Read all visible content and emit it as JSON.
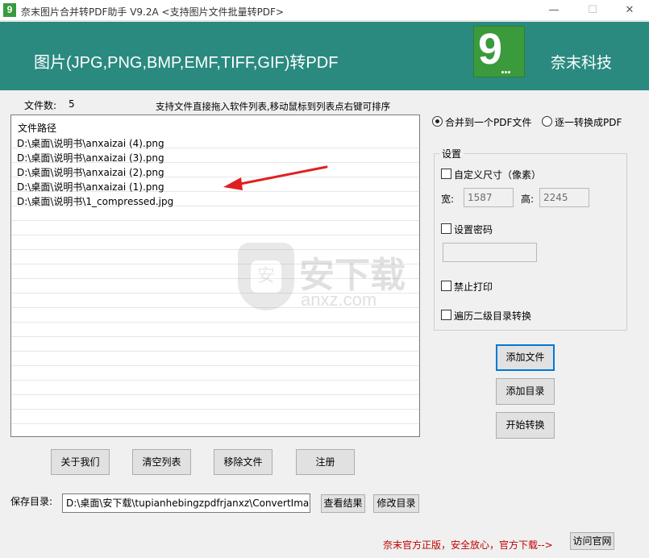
{
  "window": {
    "title": "奈末图片合并转PDF助手 V9.2A  <支持图片文件批量转PDF>",
    "icon": "9",
    "controls": {
      "minimize": "—",
      "maximize": "☐",
      "close": "✕"
    }
  },
  "banner": {
    "title": "图片(JPG,PNG,BMP,EMF,TIFF,GIF)转PDF",
    "logo_digit": "9",
    "logo_dots": "...",
    "brand": "奈末科技",
    "color": "#2a8a80"
  },
  "file_info": {
    "count_label": "文件数:",
    "count_value": "5",
    "hint": "支持文件直接拖入软件列表,移动鼠标到列表点右键可排序"
  },
  "file_list": {
    "header": "文件路径",
    "rows": [
      "D:\\桌面\\说明书\\anxaizai (4).png",
      "D:\\桌面\\说明书\\anxaizai (3).png",
      "D:\\桌面\\说明书\\anxaizai (2).png",
      "D:\\桌面\\说明书\\anxaizai (1).png",
      "D:\\桌面\\说明书\\1_compressed.jpg"
    ]
  },
  "watermark": {
    "main": "安下载",
    "sub": "anxz.com",
    "glyph": "安"
  },
  "mode": {
    "merge_label": "合并到一个PDF文件",
    "each_label": "逐一转换成PDF",
    "selected": "merge"
  },
  "settings": {
    "title": "设置",
    "custom_size_label": "自定义尺寸（像素）",
    "width_label": "宽:",
    "width_value": "1587",
    "height_label": "高:",
    "height_value": "2245",
    "password_label": "设置密码",
    "password_value": "",
    "no_print_label": "禁止打印",
    "traverse_label": "遍历二级目录转换"
  },
  "actions": {
    "add_file": "添加文件",
    "add_folder": "添加目录",
    "start": "开始转换"
  },
  "bottom_buttons": {
    "about": "关于我们",
    "clear": "清空列表",
    "remove": "移除文件",
    "register": "注册"
  },
  "save": {
    "label": "保存目录:",
    "path": "D:\\桌面\\安下载\\tupianhebingzpdfrjanxz\\ConvertImageT",
    "view_result": "查看结果",
    "change_dir": "修改目录"
  },
  "footer": {
    "note": "奈末官方正版，安全放心，官方下载-->",
    "visit": "访问官网",
    "note_color": "#c00000"
  }
}
